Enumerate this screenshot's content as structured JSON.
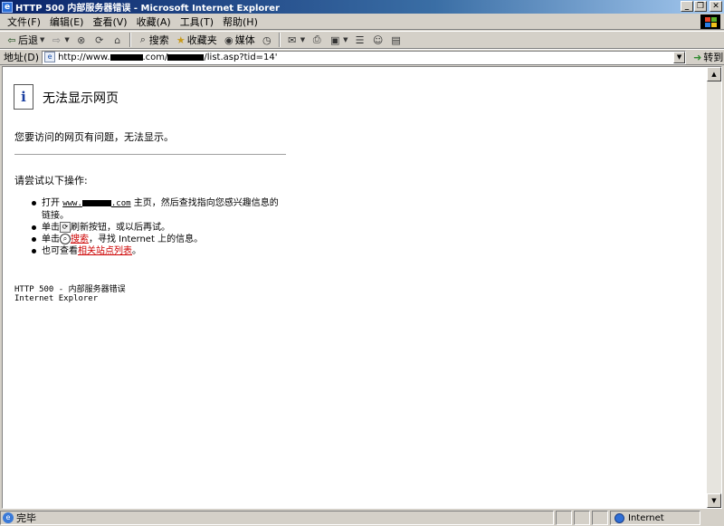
{
  "window": {
    "title": "HTTP 500 内部服务器错误 - Microsoft Internet Explorer",
    "minimize": "_",
    "restore": "❐",
    "close": "✕"
  },
  "menu": [
    "文件(F)",
    "编辑(E)",
    "查看(V)",
    "收藏(A)",
    "工具(T)",
    "帮助(H)"
  ],
  "toolbar": {
    "back": "后退",
    "search": "搜索",
    "favorites": "收藏夹",
    "media": "媒体"
  },
  "address": {
    "label": "地址(D)",
    "url_prefix": "http://www.",
    "url_mid": ".com/",
    "url_suffix": "/list.asp?tid=14'",
    "go": "转到"
  },
  "page": {
    "heading": "无法显示网页",
    "description": "您要访问的网页有问题，无法显示。",
    "try_title": "请尝试以下操作:",
    "step1_prefix": "打开",
    "step1_link_prefix": "www.",
    "step1_link_suffix": ".com",
    "step1_suffix": "主页，然后查找指向您感兴趣信息的链接。",
    "step2_prefix": "单击",
    "step2_suffix": "刷新按钮，或以后再试。",
    "step3_prefix": "单击",
    "step3_link": "搜索",
    "step3_suffix": "，寻找 Internet 上的信息。",
    "step4_prefix": "也可查看",
    "step4_link": "相关站点列表",
    "step4_suffix": "。",
    "footer_code": "HTTP 500 - 内部服务器错误",
    "footer_app": "Internet Explorer"
  },
  "status": {
    "text": "完毕",
    "zone": "Internet"
  }
}
